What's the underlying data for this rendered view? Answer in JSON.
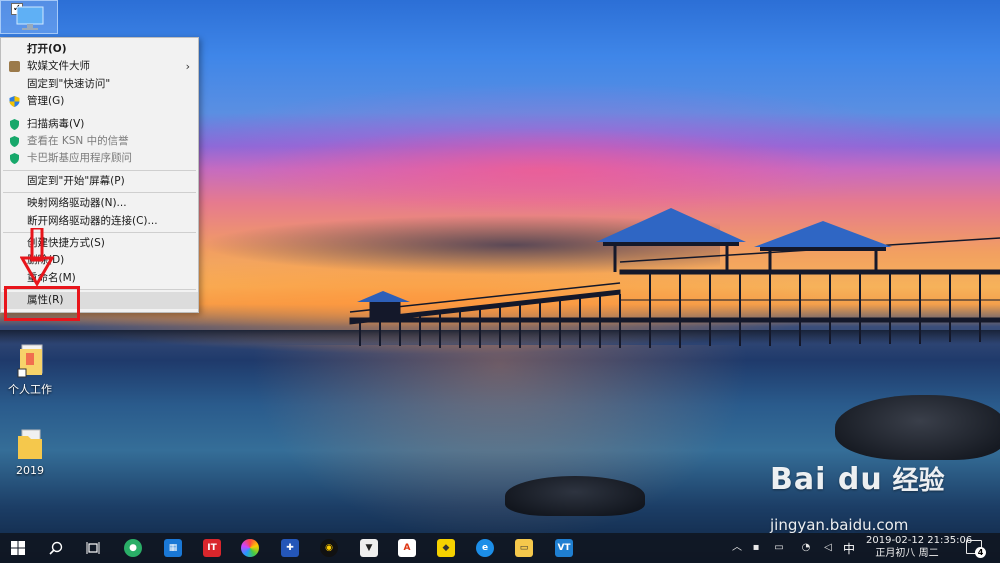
{
  "desktop": {
    "icons": [
      {
        "label": "",
        "name": "this-pc"
      },
      {
        "label": "个人工作",
        "name": "folder-personal-work"
      },
      {
        "label": "2019",
        "name": "folder-2019"
      }
    ]
  },
  "context_menu": {
    "items": [
      {
        "label": "打开(O)",
        "style": "bold",
        "icon": ""
      },
      {
        "label": "软媒文件大师",
        "style": "normal",
        "icon": "ruanmei-icon",
        "submenu": true
      },
      {
        "label": "固定到\"快速访问\"",
        "style": "normal",
        "icon": ""
      },
      {
        "label": "管理(G)",
        "style": "normal",
        "icon": "shield-uac-icon"
      },
      {
        "label": "扫描病毒(V)",
        "style": "normal",
        "icon": "kaspersky-icon"
      },
      {
        "label": "查看在 KSN 中的信誉",
        "style": "dim",
        "icon": "kaspersky-icon"
      },
      {
        "label": "卡巴斯基应用程序顾问",
        "style": "dim",
        "icon": "kaspersky-icon"
      },
      {
        "label": "固定到\"开始\"屏幕(P)",
        "style": "normal",
        "icon": ""
      },
      {
        "label": "映射网络驱动器(N)...",
        "style": "normal",
        "icon": ""
      },
      {
        "label": "断开网络驱动器的连接(C)...",
        "style": "normal",
        "icon": ""
      },
      {
        "label": "创建快捷方式(S)",
        "style": "normal",
        "icon": ""
      },
      {
        "label": "删除(D)",
        "style": "normal",
        "icon": ""
      },
      {
        "label": "重命名(M)",
        "style": "normal",
        "icon": ""
      },
      {
        "label": "属性(R)",
        "style": "highlight",
        "icon": ""
      }
    ]
  },
  "annotation": {
    "arrow_color": "#e8151b",
    "highlight_target": "属性(R)"
  },
  "watermark": {
    "logo": "Bai du",
    "cn": "经验",
    "url": "jingyan.baidu.com"
  },
  "taskbar": {
    "apps": [
      "windows-start-icon",
      "search-icon",
      "task-view-icon",
      "wechat-icon",
      "calculator-icon",
      "netease-icon",
      "colorful-app-icon",
      "tools-icon",
      "qq-icon",
      "fox-icon",
      "adobe-reader-icon",
      "yellow-app-icon",
      "ie-browser-icon",
      "file-explorer-icon",
      "vm-app-icon"
    ],
    "tray": {
      "ime": "中",
      "time": "2019-02-12  21:35:06",
      "date": "正月初八 周二",
      "notifications": "4"
    }
  },
  "colors": {
    "menu_bg": "#f2f2f2",
    "menu_highlight": "#dcdcdc",
    "taskbar_bg": "#101620"
  }
}
